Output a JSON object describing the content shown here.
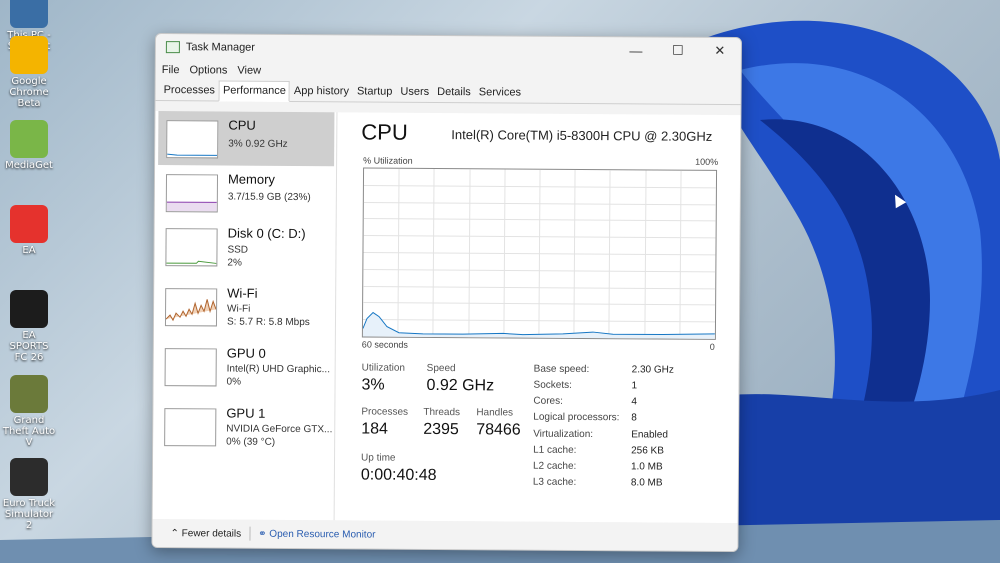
{
  "desktop": {
    "icons": [
      {
        "label": "This PC - Shortcut",
        "color": "#3a6ea5"
      },
      {
        "label": "Google Chrome Beta",
        "color": "#f4b400"
      },
      {
        "label": "MediaGet",
        "color": "#7ab648"
      },
      {
        "label": "EA",
        "color": "#e5322d"
      },
      {
        "label": "EA SPORTS FC 26",
        "color": "#1c1c1c"
      },
      {
        "label": "Grand Theft Auto V",
        "color": "#6b7a3a"
      },
      {
        "label": "Euro Truck Simulator 2",
        "color": "#2c2c2c"
      }
    ]
  },
  "window": {
    "title": "Task Manager",
    "controls": {
      "minimize": "—",
      "maximize": "☐",
      "close": "✕"
    },
    "menu": [
      "File",
      "Options",
      "View"
    ],
    "tabs": [
      "Processes",
      "Performance",
      "App history",
      "Startup",
      "Users",
      "Details",
      "Services"
    ],
    "active_tab": "Performance"
  },
  "sidebar": {
    "items": [
      {
        "title": "CPU",
        "lines": [
          "3% 0.92 GHz"
        ]
      },
      {
        "title": "Memory",
        "lines": [
          "3.7/15.9 GB (23%)"
        ]
      },
      {
        "title": "Disk 0 (C: D:)",
        "lines": [
          "SSD",
          "2%"
        ]
      },
      {
        "title": "Wi-Fi",
        "lines": [
          "Wi-Fi",
          "S: 5.7 R: 5.8 Mbps"
        ]
      },
      {
        "title": "GPU 0",
        "lines": [
          "Intel(R) UHD Graphic...",
          "0%"
        ]
      },
      {
        "title": "GPU 1",
        "lines": [
          "NVIDIA GeForce GTX...",
          "0% (39 °C)"
        ]
      }
    ]
  },
  "main": {
    "title": "CPU",
    "cpu_name": "Intel(R) Core(TM) i5-8300H CPU @ 2.30GHz",
    "graph": {
      "y_label": "% Utilization",
      "y_max": "100%",
      "x_left": "60 seconds",
      "x_right": "0"
    },
    "stats": {
      "utilization_label": "Utilization",
      "utilization": "3%",
      "speed_label": "Speed",
      "speed": "0.92 GHz",
      "processes_label": "Processes",
      "processes": "184",
      "threads_label": "Threads",
      "threads": "2395",
      "handles_label": "Handles",
      "handles": "78466",
      "uptime_label": "Up time",
      "uptime": "0:00:40:48"
    },
    "details": [
      {
        "key": "Base speed:",
        "value": "2.30 GHz"
      },
      {
        "key": "Sockets:",
        "value": "1"
      },
      {
        "key": "Cores:",
        "value": "4"
      },
      {
        "key": "Logical processors:",
        "value": "8"
      },
      {
        "key": "Virtualization:",
        "value": "Enabled"
      },
      {
        "key": "L1 cache:",
        "value": "256 KB"
      },
      {
        "key": "L2 cache:",
        "value": "1.0 MB"
      },
      {
        "key": "L3 cache:",
        "value": "8.0 MB"
      }
    ]
  },
  "footer": {
    "fewer_details": "Fewer details",
    "open_resource_monitor": "Open Resource Monitor"
  }
}
